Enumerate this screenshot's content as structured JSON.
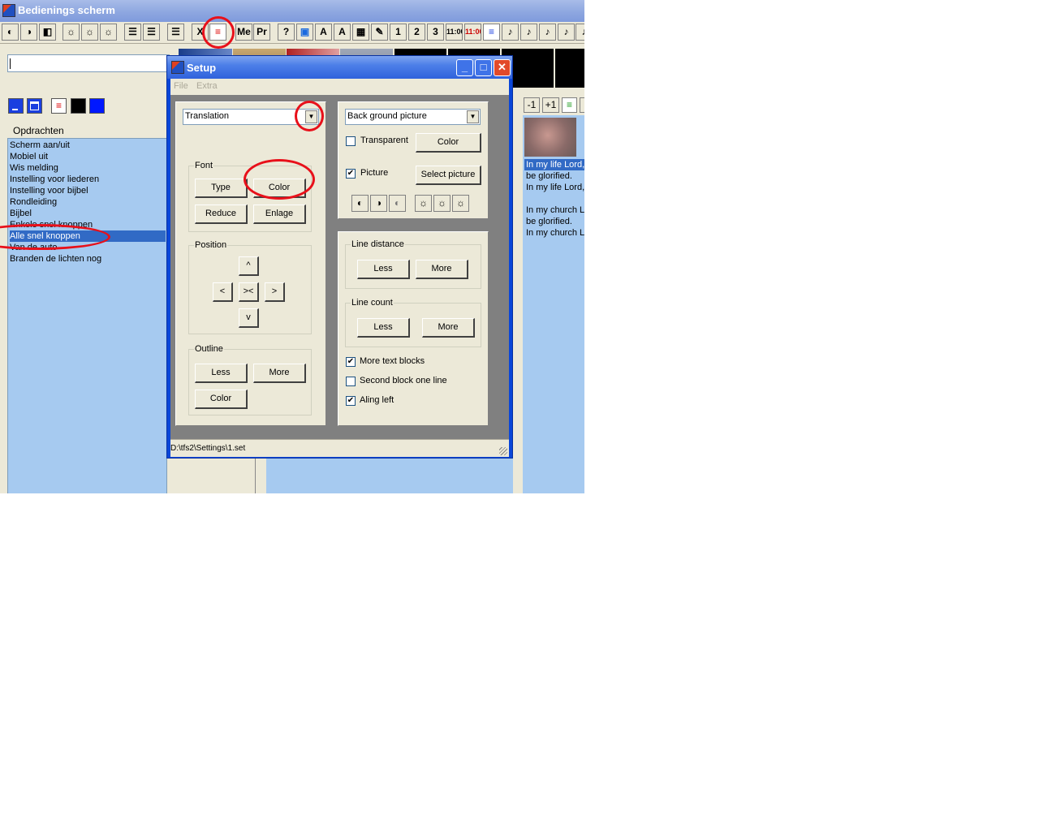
{
  "main_window": {
    "title": "Bedienings scherm",
    "toolbar": {
      "buttons": [
        {
          "name": "contrast-dark-icon",
          "text": "◐"
        },
        {
          "name": "contrast-half-icon",
          "text": "◑"
        },
        {
          "name": "contrast-light-icon",
          "text": "◧"
        },
        {
          "name": "brightness-high-icon",
          "text": "☼"
        },
        {
          "name": "brightness-mid-icon",
          "text": "☼"
        },
        {
          "name": "brightness-low-icon",
          "text": "☼"
        },
        {
          "name": "align-left-icon",
          "text": "☰"
        },
        {
          "name": "align-center-icon",
          "text": "☰"
        },
        {
          "name": "align-justify-icon",
          "text": "☰"
        },
        {
          "name": "close-x-icon",
          "text": "X"
        },
        {
          "name": "text-color-red-icon",
          "text": "≡"
        },
        {
          "name": "me-button",
          "text": "Me"
        },
        {
          "name": "pr-button",
          "text": "Pr"
        },
        {
          "name": "help-icon",
          "text": "?"
        },
        {
          "name": "picture-icon",
          "text": "▣"
        },
        {
          "name": "font-large-icon",
          "text": "A"
        },
        {
          "name": "font-small-icon",
          "text": "A"
        },
        {
          "name": "image-color-icon",
          "text": "▦"
        },
        {
          "name": "pencil-icon",
          "text": "✎"
        },
        {
          "name": "one-button",
          "text": "1"
        },
        {
          "name": "two-button",
          "text": "2"
        },
        {
          "name": "three-button",
          "text": "3"
        },
        {
          "name": "clock-button",
          "text": "11:00"
        },
        {
          "name": "clock-off-button",
          "text": "11:00"
        },
        {
          "name": "list-blue-icon",
          "text": "≡"
        },
        {
          "name": "note-1-icon",
          "text": "♪"
        },
        {
          "name": "note-2-icon",
          "text": "♪"
        },
        {
          "name": "note-3-icon",
          "text": "♪"
        },
        {
          "name": "note-4-icon",
          "text": "♪"
        },
        {
          "name": "note-5-icon",
          "text": "♪"
        }
      ]
    },
    "left_panel": {
      "commands_label": "Opdrachten",
      "items": [
        "Scherm aan/uit",
        "Mobiel uit",
        "Wis melding",
        "Instelling voor liederen",
        "Instelling voor bijbel",
        "Rondleiding",
        "Bijbel",
        "Enkele snel knoppen",
        "Alle snel knoppen",
        "Van de auto",
        "Branden de lichten nog"
      ],
      "selected_index": 8
    },
    "right_panel": {
      "buttons": [
        "-1",
        "+1"
      ],
      "lines": [
        "In my life Lord,",
        "be glorified.",
        "In my life Lord,",
        "",
        "In my church L",
        "be glorified.",
        "In my church L"
      ]
    }
  },
  "setup_dialog": {
    "title": "Setup",
    "menu": [
      "File",
      "Extra"
    ],
    "left": {
      "mode_select": "Translation",
      "font": {
        "label": "Font",
        "type": "Type",
        "color": "Color",
        "reduce": "Reduce",
        "enlarge": "Enlage"
      },
      "position": {
        "label": "Position",
        "up": "^",
        "left": "<",
        "center": "><",
        "right": ">",
        "down": "v"
      },
      "outline": {
        "label": "Outline",
        "less": "Less",
        "more": "More",
        "color": "Color"
      }
    },
    "right": {
      "background_select": "Back ground picture",
      "transparent_label": "Transparent",
      "transparent_checked": false,
      "color_button": "Color",
      "picture_label": "Picture",
      "picture_checked": true,
      "select_picture": "Select picture",
      "line_distance": {
        "label": "Line distance",
        "less": "Less",
        "more": "More"
      },
      "line_count": {
        "label": "Line count",
        "less": "Less",
        "more": "More"
      },
      "more_text_blocks": {
        "label": "More text blocks",
        "checked": true
      },
      "second_block_one_line": {
        "label": "Second block one line",
        "checked": false
      },
      "align_left": {
        "label": "Aling left",
        "checked": true
      }
    },
    "status_path": "D:\\tfs2\\Settings\\1.set"
  },
  "colors": {
    "highlight": "#e8101a",
    "list_bg": "#a6caf0",
    "selection": "#316ac5",
    "dialog_frame": "#0a46d8"
  }
}
